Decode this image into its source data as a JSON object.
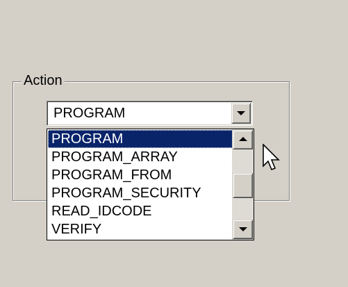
{
  "group": {
    "label": "Action"
  },
  "combo": {
    "value": "PROGRAM"
  },
  "dropdown": {
    "items": [
      "PROGRAM",
      "PROGRAM_ARRAY",
      "PROGRAM_FROM",
      "PROGRAM_SECURITY",
      "READ_IDCODE",
      "VERIFY"
    ],
    "selected_index": 0
  },
  "icons": {
    "combo_button": "chevron-down-icon",
    "scroll_up": "arrow-up-icon",
    "scroll_down": "arrow-down-icon",
    "pointer": "mouse-cursor-icon"
  },
  "colors": {
    "face": "#d4d0c8",
    "highlight": "#0a246a",
    "window": "#ffffff"
  }
}
